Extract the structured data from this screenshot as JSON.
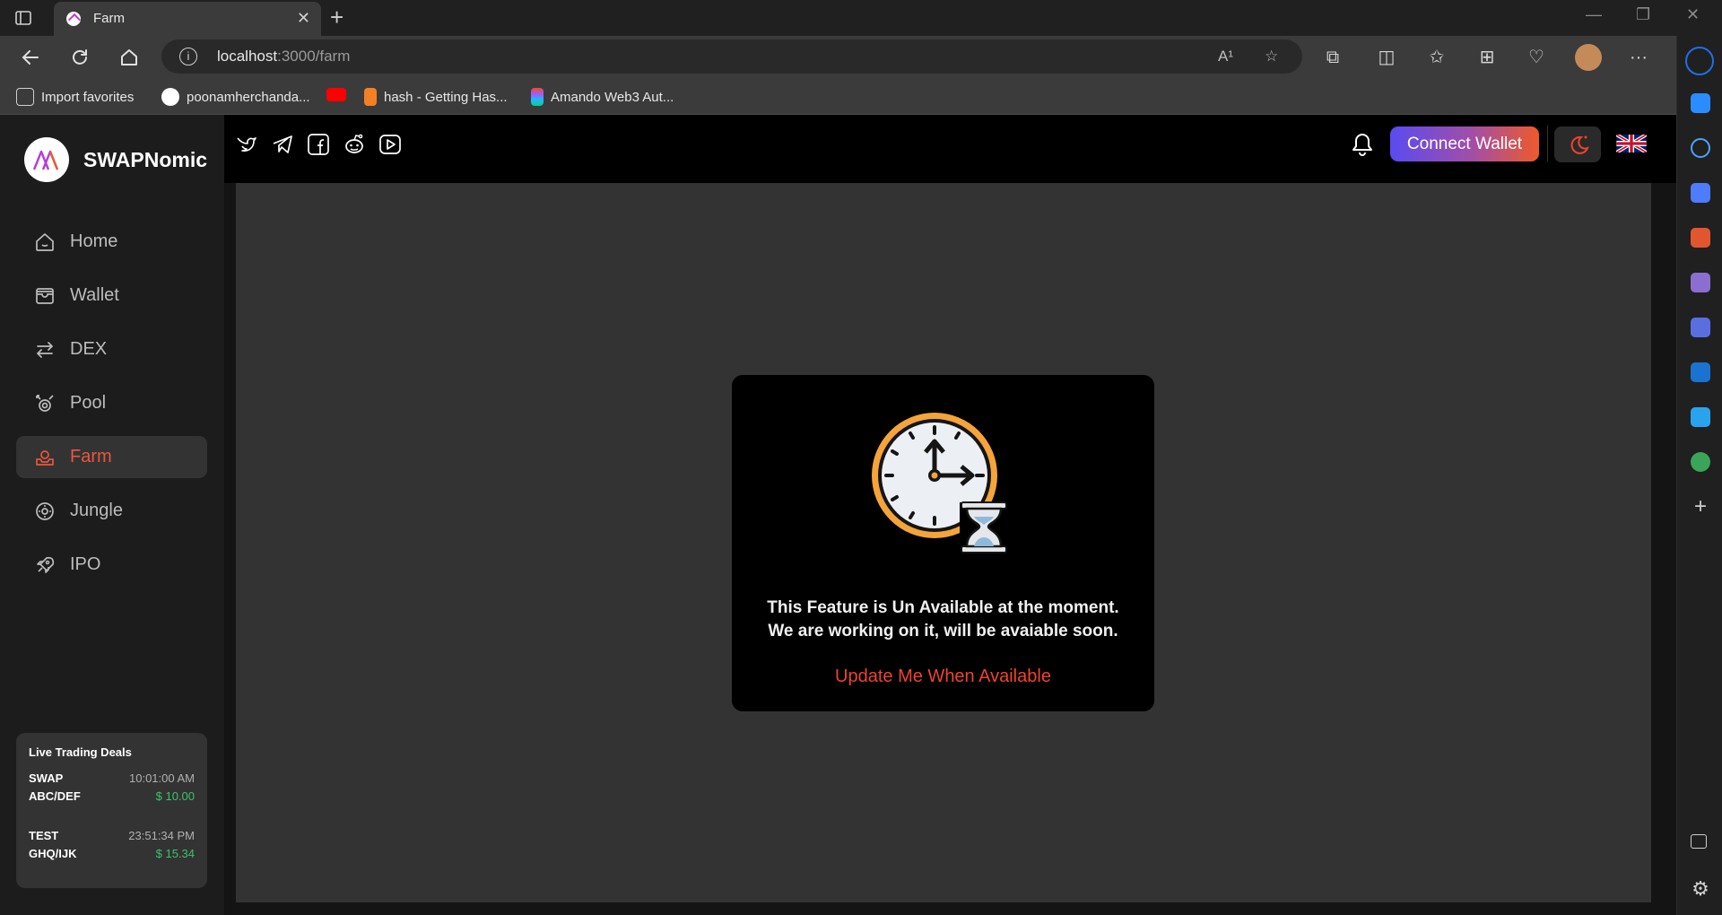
{
  "browser": {
    "tab_title": "Farm",
    "url_host": "localhost",
    "url_path": ":3000/farm",
    "read_aloud_label": "A¹",
    "favorites": [
      {
        "label": "Import favorites",
        "icon": "import-favorites-icon"
      },
      {
        "label": "poonamherchanda...",
        "icon": "github-icon"
      },
      {
        "label": "",
        "icon": "youtube-icon"
      },
      {
        "label": "hash - Getting Has...",
        "icon": "stackoverflow-icon"
      },
      {
        "label": "Amando Web3 Aut...",
        "icon": "figma-icon"
      }
    ]
  },
  "app": {
    "brand": "SWAPNomic",
    "menu": [
      {
        "label": "Home",
        "icon": "home-icon",
        "active": false
      },
      {
        "label": "Wallet",
        "icon": "wallet-icon",
        "active": false
      },
      {
        "label": "DEX",
        "icon": "swap-arrows-icon",
        "active": false
      },
      {
        "label": "Pool",
        "icon": "pool-icon",
        "active": false
      },
      {
        "label": "Farm",
        "icon": "farm-icon",
        "active": true
      },
      {
        "label": "Jungle",
        "icon": "jungle-icon",
        "active": false
      },
      {
        "label": "IPO",
        "icon": "rocket-icon",
        "active": false
      }
    ],
    "deals": {
      "title": "Live Trading Deals",
      "items": [
        {
          "symbol": "SWAP",
          "pair": "ABC/DEF",
          "time": "10:01:00 AM",
          "price": "$ 10.00"
        },
        {
          "symbol": "TEST",
          "pair": "GHQ/IJK",
          "time": "23:51:34 PM",
          "price": "$ 15.34"
        }
      ]
    },
    "topbar": {
      "connect_label": "Connect Wallet",
      "social_icons": [
        "twitter-icon",
        "telegram-icon",
        "facebook-icon",
        "reddit-icon",
        "youtube-icon"
      ]
    },
    "notice": {
      "line1": "This Feature is Un Available at the moment.",
      "line2": "We are working on it, will be avaiable soon.",
      "action": "Update Me When Available"
    }
  },
  "colors": {
    "accent": "#e9573d",
    "link": "#f0432e",
    "price_green": "#3cc36b"
  }
}
